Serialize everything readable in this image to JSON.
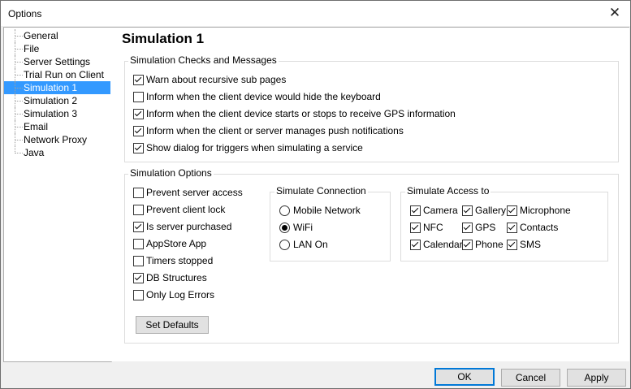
{
  "window": {
    "title": "Options",
    "close_glyph": "✕"
  },
  "nav": {
    "items": [
      {
        "label": "General"
      },
      {
        "label": "File"
      },
      {
        "label": "Server Settings"
      },
      {
        "label": "Trial Run on Client"
      },
      {
        "label": "Simulation 1",
        "selected": true
      },
      {
        "label": "Simulation 2"
      },
      {
        "label": "Simulation 3"
      },
      {
        "label": "Email"
      },
      {
        "label": "Network Proxy"
      },
      {
        "label": "Java"
      }
    ]
  },
  "page": {
    "title": "Simulation 1"
  },
  "checks_group": {
    "legend": "Simulation Checks and Messages",
    "items": [
      {
        "label": "Warn about recursive sub pages",
        "checked": true
      },
      {
        "label": "Inform when the client device would hide the keyboard",
        "checked": false
      },
      {
        "label": "Inform when the client device starts or stops to receive GPS information",
        "checked": true
      },
      {
        "label": "Inform when the client or server manages push notifications",
        "checked": true
      },
      {
        "label": "Show dialog for triggers when simulating a service",
        "checked": true
      }
    ]
  },
  "options_group": {
    "legend": "Simulation Options",
    "items": [
      {
        "label": "Prevent server access",
        "checked": false
      },
      {
        "label": "Prevent client lock",
        "checked": false
      },
      {
        "label": "Is server purchased",
        "checked": true
      },
      {
        "label": "AppStore App",
        "checked": false
      },
      {
        "label": "Timers stopped",
        "checked": false
      },
      {
        "label": "DB Structures",
        "checked": true
      },
      {
        "label": "Only Log Errors",
        "checked": false
      }
    ],
    "set_defaults_label": "Set Defaults"
  },
  "connection": {
    "legend": "Simulate Connection",
    "options": [
      {
        "label": "Mobile Network",
        "selected": false
      },
      {
        "label": "WiFi",
        "selected": true
      },
      {
        "label": "LAN On",
        "selected": false
      }
    ]
  },
  "access": {
    "legend": "Simulate Access to",
    "items": [
      {
        "label": "Camera",
        "checked": true
      },
      {
        "label": "Gallery",
        "checked": true
      },
      {
        "label": "Microphone",
        "checked": true
      },
      {
        "label": "NFC",
        "checked": true
      },
      {
        "label": "GPS",
        "checked": true
      },
      {
        "label": "Contacts",
        "checked": true
      },
      {
        "label": "Calendar",
        "checked": true
      },
      {
        "label": "Phone",
        "checked": true
      },
      {
        "label": "SMS",
        "checked": true
      }
    ]
  },
  "footer": {
    "ok_label": "OK",
    "cancel_label": "Cancel",
    "apply_label": "Apply"
  }
}
